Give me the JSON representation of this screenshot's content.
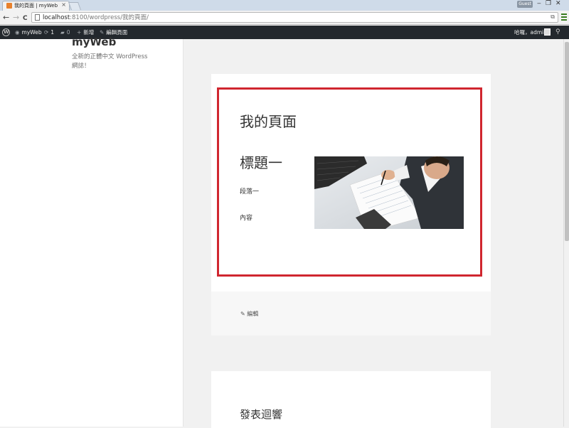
{
  "browser": {
    "tab_title": "我的頁面 | myWeb",
    "tab_close": "×",
    "profile_label": "Guest",
    "url_host": "localhost",
    "url_path": ":8100/wordpress/我的頁面/",
    "minimize": "‒",
    "restore": "❐",
    "close": "✕",
    "back": "←",
    "forward": "→",
    "reload": "C"
  },
  "adminbar": {
    "site_name": "myWeb",
    "updates_count": "1",
    "comments_count": "0",
    "new_label": "新增",
    "edit_page_label": "編輯頁面",
    "greeting": "哈囉，admin"
  },
  "site": {
    "title": "myWeb",
    "description": "全新的正體中文 WordPress 網誌！"
  },
  "page": {
    "title": "我的頁面",
    "heading": "標題一",
    "paragraph1": "段落一",
    "paragraph2": "內容",
    "edit_link": "編輯"
  },
  "comments": {
    "title": "發表迴響"
  },
  "colors": {
    "highlight_border": "#d0262f",
    "adminbar_bg": "#23282d"
  }
}
